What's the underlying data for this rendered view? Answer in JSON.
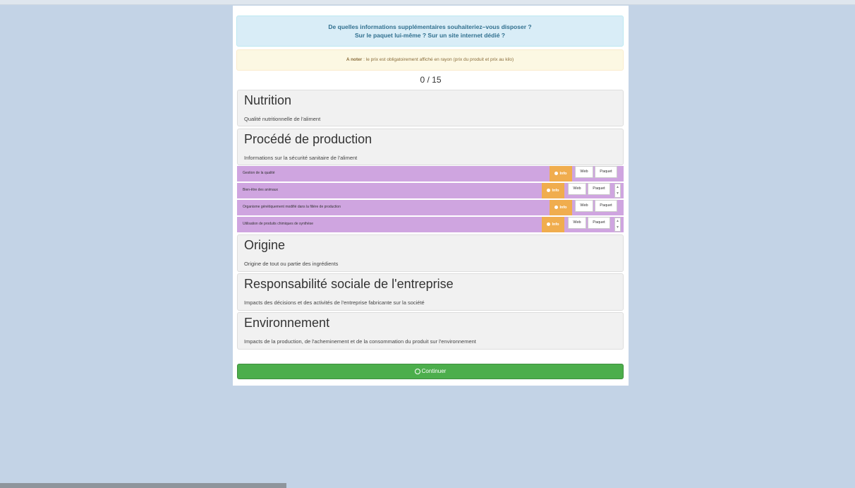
{
  "question": {
    "line1": "De quelles informations supplémentaires souhaiteriez–vous disposer ?",
    "line2": "Sur le paquet lui-même ? Sur un site internet dédié ?"
  },
  "note": {
    "prefix": "A noter",
    "text": " : le prix est obligatoirement affiché en rayon (prix du produit et prix au kilo)"
  },
  "counter": "0 / 15",
  "categories": [
    {
      "title": "Nutrition",
      "description": "Qualité nutritionnelle de l'aliment"
    },
    {
      "title": "Procédé de production",
      "description": "Informations sur la sécurité sanitaire de l'aliment"
    },
    {
      "title": "Origine",
      "description": "Origine de tout ou partie des ingrédients"
    },
    {
      "title": "Responsabilité sociale de l'entreprise",
      "description": "Impacts des décisions et des activités de l'entreprise fabricante sur la société"
    },
    {
      "title": "Environnement",
      "description": "Impacts de la production, de l'acheminement et de la consommation du produit sur l'environnement"
    }
  ],
  "subitems": [
    {
      "label": "Gestion de la qualité"
    },
    {
      "label": "Bien-être des animaux"
    },
    {
      "label": "Organisme génétiquement modifié dans la filière de production"
    },
    {
      "label": "Utilisation de produits chimiques de synthèse"
    }
  ],
  "buttons": {
    "info": "Info",
    "web": "Web",
    "paquet": "Paquet",
    "continue": "Continuer",
    "spin_up": "▲",
    "spin_down": "▼"
  },
  "colors": {
    "question_bg": "#d9edf7",
    "note_bg": "#fcf8e3",
    "subitem_bg": "#cfa5e0",
    "info_btn": "#f0ad4e",
    "continue_btn": "#4cae4c"
  },
  "icons": {
    "info": "info-circle-icon",
    "continue": "check-circle-icon"
  }
}
